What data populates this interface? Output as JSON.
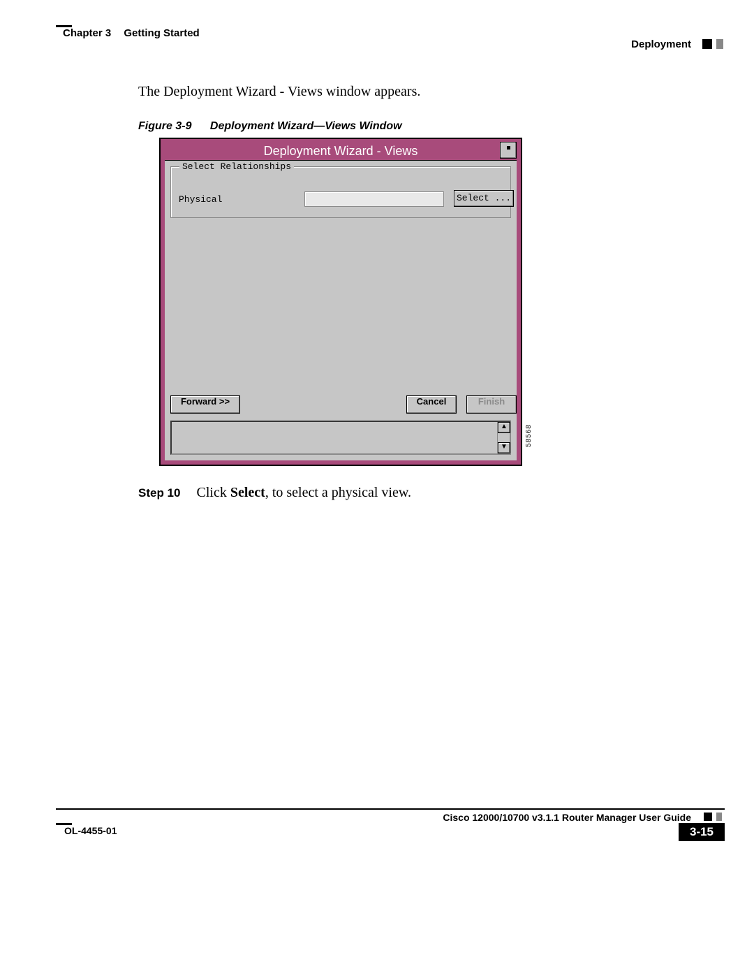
{
  "header": {
    "chapter_label": "Chapter 3",
    "chapter_title": "Getting Started",
    "section_right": "Deployment"
  },
  "body": {
    "lead": "The Deployment Wizard - Views window appears.",
    "figure_number": "Figure 3-9",
    "figure_title": "Deployment Wizard—Views Window"
  },
  "window": {
    "title": "Deployment Wizard - Views",
    "group_legend": "Select Relationships",
    "physical_label": "Physical",
    "select_button": "Select ...",
    "forward_button": "Forward >>",
    "cancel_button": "Cancel",
    "finish_button": "Finish",
    "image_id": "58568"
  },
  "step": {
    "number": "Step 10",
    "pre": "Click ",
    "bold": "Select",
    "post": ", to select a physical view."
  },
  "footer": {
    "guide": "Cisco 12000/10700 v3.1.1 Router Manager User Guide",
    "ol": "OL-4455-01",
    "page": "3-15"
  }
}
